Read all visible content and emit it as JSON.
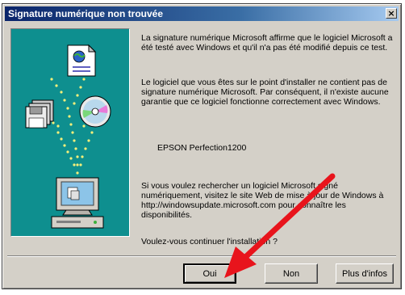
{
  "window": {
    "title": "Signature numérique non trouvée",
    "close_glyph": "×"
  },
  "message": {
    "paragraph1": "La signature numérique Microsoft affirme que le logiciel Microsoft a été testé avec Windows et qu'il n'a pas été modifié depuis ce test.",
    "paragraph2": "Le logiciel que vous êtes sur le point d'installer ne contient pas de signature numérique Microsoft. Par conséquent, il n'existe aucune garantie que ce logiciel fonctionne correctement avec Windows.",
    "product": "EPSON Perfection1200",
    "paragraph3": "Si vous voulez rechercher un logiciel Microsoft signé numériquement, visitez le site Web de mise à jour de Windows à http://windowsupdate.microsoft.com pour connaître les disponibilités.",
    "question": "Voulez-vous continuer l'installation ?"
  },
  "buttons": {
    "yes": "Oui",
    "no": "Non",
    "more_info": "Plus d'infos"
  },
  "annotation": {
    "arrow_color": "#e8141c"
  },
  "illustration": {
    "background_color": "#0e8f8f",
    "icons": [
      "document-globe-icon",
      "floppy-disks-icon",
      "cd-rom-icon",
      "computer-icon"
    ]
  }
}
